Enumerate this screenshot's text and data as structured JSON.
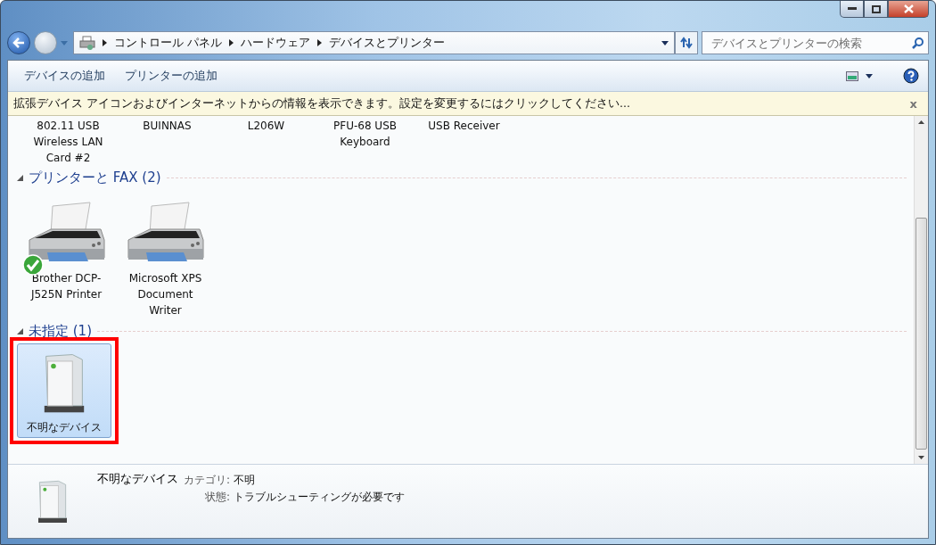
{
  "address_bar": {
    "crumbs": [
      "コントロール パネル",
      "ハードウェア",
      "デバイスとプリンター"
    ]
  },
  "search": {
    "placeholder": "デバイスとプリンターの検索"
  },
  "toolbar": {
    "buttons": [
      "デバイスの追加",
      "プリンターの追加"
    ]
  },
  "info_bar": {
    "text": "拡張デバイス アイコンおよびインターネットからの情報を表示できます。設定を変更するにはクリックしてください...",
    "close": "x"
  },
  "top_row": [
    {
      "label": "802.11 USB Wireless LAN Card #2"
    },
    {
      "label": "BUINNAS"
    },
    {
      "label": "L206W"
    },
    {
      "label": "PFU-68 USB Keyboard"
    },
    {
      "label": "USB Receiver"
    }
  ],
  "sections": [
    {
      "title": "プリンターと FAX (2)",
      "expanded": true,
      "items": [
        {
          "kind": "printer",
          "label": "Brother DCP-J525N Printer",
          "default": true,
          "selected": false,
          "highlighted": false
        },
        {
          "kind": "printer",
          "label": "Microsoft XPS Document Writer",
          "default": false,
          "selected": false,
          "highlighted": false
        }
      ]
    },
    {
      "title": "未指定 (1)",
      "expanded": true,
      "items": [
        {
          "kind": "device",
          "label": "不明なデバイス",
          "default": false,
          "selected": true,
          "highlighted": true
        }
      ]
    }
  ],
  "details": {
    "name": "不明なデバイス",
    "fields": [
      {
        "label": "カテゴリ:",
        "value": "不明"
      },
      {
        "label": "状態:",
        "value": "トラブルシューティングが必要です"
      }
    ]
  }
}
